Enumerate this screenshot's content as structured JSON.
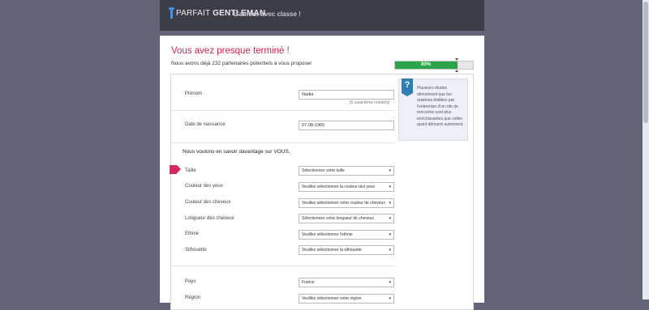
{
  "header": {
    "logo_light": "PARFAIT",
    "logo_bold": "GENTLEMAN",
    "tagline": "L'amour avec classe !"
  },
  "page": {
    "title": "Vous avez presque terminé !",
    "subtitle": "Nous avons déjà 232 partenaires potentiels à vous proposer",
    "progress_label": "80%",
    "progress_value": 0.8
  },
  "form": {
    "first_name": {
      "label": "Prénom",
      "value": "Nadia",
      "hint": "[5 caractères restants]"
    },
    "birth_date": {
      "label": "Date de naissance",
      "value": "07-08-1965"
    },
    "about_heading": "Nous voulons en savoir davantage sur VOUS.",
    "fields": [
      {
        "label": "Taille",
        "value": "Sélectionnez votre taille"
      },
      {
        "label": "Couleur des yeux",
        "value": "Veuillez sélectionner la couleur des yeux"
      },
      {
        "label": "Couleur des cheveux",
        "value": "Veuillez sélectionner votre couleur de cheveux"
      },
      {
        "label": "Longueur des cheveux",
        "value": "Sélectionnez votre longueur de cheveux"
      },
      {
        "label": "Ethnie",
        "value": "Veuillez sélectionner l'ethnie"
      },
      {
        "label": "Silhouette",
        "value": "Veuillez sélectionner la silhouette"
      }
    ],
    "country": {
      "label": "Pays",
      "value": "France"
    },
    "region": {
      "label": "Région",
      "value": "Veuillez sélectionner votre région"
    }
  },
  "info_box": {
    "icon": "question-icon",
    "icon_glyph": "?",
    "text": "Plusieurs études démontrent que les relations établies par l'entremise d'un site de rencontre sont plus enrichissantes que celles ayant démarré autrement."
  },
  "colors": {
    "accent": "#d2234e",
    "progress": "#2aa34a",
    "header_bg": "#3d3d47",
    "outer_bg": "#646479"
  }
}
